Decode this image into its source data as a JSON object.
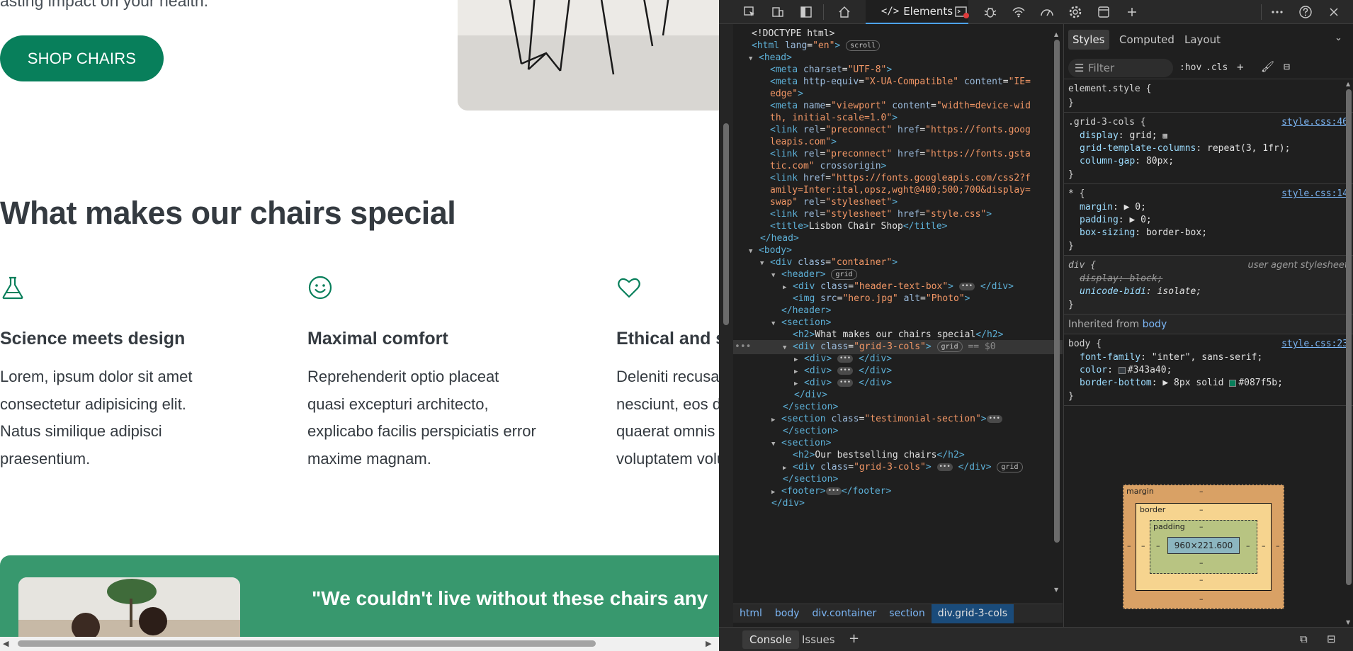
{
  "site": {
    "hero_text": "asting impact on your health.",
    "shop_button": "SHOP CHAIRS",
    "section_title": "What makes our chairs special",
    "features": [
      {
        "title": "Science meets design",
        "lines": [
          "Lorem, ipsum dolor sit amet",
          "consectetur adipisicing elit.",
          "Natus similique adipisci",
          "praesentium."
        ]
      },
      {
        "title": "Maximal comfort",
        "lines": [
          "Reprehenderit optio placeat",
          "quasi excepturi architecto,",
          "explicabo facilis perspiciatis error",
          "maxime magnam."
        ]
      },
      {
        "title": "Ethical and s",
        "lines": [
          "Deleniti recusar",
          "nesciunt, eos d",
          "quaerat omnis e",
          "voluptatem volu"
        ]
      }
    ],
    "quote": "\"We couldn't live without these chairs any",
    "colors": {
      "brand": "#087f5b",
      "testimonial_bg": "#38986e",
      "text": "#343a40"
    },
    "icons": [
      "flask-icon",
      "smiley-icon",
      "heart-icon"
    ]
  },
  "devtools": {
    "tabs": {
      "elements": "Elements"
    },
    "toolbar_icons": [
      "inspect-icon",
      "device-icon",
      "dock-icon",
      "home-icon",
      "elements-icon",
      "console-icon",
      "bug-icon",
      "network-icon",
      "performance-icon",
      "settings-icon",
      "application-icon",
      "add-tab-icon",
      "more-icon",
      "help-icon",
      "close-icon"
    ],
    "dom": {
      "doctype": "<!DOCTYPE html>",
      "html_open_tag": "html",
      "html_lang_attr": "lang",
      "html_lang": "\"en\"",
      "scroll_badge": "scroll",
      "head_tag": "head",
      "meta1_tag": "meta",
      "meta1_attr": "charset",
      "meta1_val": "\"UTF-8\"",
      "meta2_tag": "meta",
      "meta2_attr": "http-equiv",
      "meta2_val": "\"X-UA-Compatible\"",
      "meta2_attr2": "content",
      "meta2_val2": "\"IE=",
      "meta2_cont": "edge\"",
      "meta3_tag": "meta",
      "meta3_attr": "name",
      "meta3_val": "\"viewport\"",
      "meta3_attr2": "content",
      "meta3_val2": "\"width=device-wid",
      "meta3_cont": "th, initial-scale=1.0\"",
      "link1_tag": "link",
      "link1_attr": "rel",
      "link1_val": "\"preconnect\"",
      "link1_attr2": "href",
      "link1_val2": "\"https://fonts.goog",
      "link1_cont": "leapis.com\"",
      "link2_tag": "link",
      "link2_attr": "rel",
      "link2_val": "\"preconnect\"",
      "link2_attr2": "href",
      "link2_val2": "\"https://fonts.gsta",
      "link2_cont": "tic.com\"",
      "link2_attr3": "crossorigin",
      "link3_tag": "link",
      "link3_attr": "href",
      "link3_val": "\"https://fonts.googleapis.com/css2?f",
      "link3_cont1": "amily=Inter:ital,opsz,wght@400;500;700&display=",
      "link3_cont2": "swap\"",
      "link3_attr2": "rel",
      "link3_val2": "\"stylesheet\"",
      "link4_tag": "link",
      "link4_attr": "rel",
      "link4_val": "\"stylesheet\"",
      "link4_attr2": "href",
      "link4_val2": "\"style.css\"",
      "title_tag": "title",
      "title_text": "Lisbon Chair Shop",
      "head_close": "head",
      "body_tag": "body",
      "container_tag": "div",
      "container_attr": "class",
      "container_val": "\"container\"",
      "header_tag": "header",
      "grid_badge": "grid",
      "htb_tag": "div",
      "htb_attr": "class",
      "htb_val": "\"header-text-box\"",
      "img_tag": "img",
      "img_attr": "src",
      "img_val": "\"hero.jpg\"",
      "img_attr2": "alt",
      "img_val2": "\"Photo\"",
      "header_close": "header",
      "section_tag": "section",
      "h2_tag": "h2",
      "h2_text": "What makes our chairs special",
      "grid_tag": "div",
      "grid_attr": "class",
      "grid_val": "\"grid-3-cols\"",
      "grid_marker": "== $0",
      "div_tag": "div",
      "section_close": "section",
      "tsection_attr": "class",
      "tsection_val": "\"testimonial-section\"",
      "h2b_text": "Our bestselling chairs",
      "footer_tag": "footer",
      "dots": "•••"
    },
    "breadcrumbs": [
      "html",
      "body",
      "div.container",
      "section",
      "div.grid-3-cols"
    ],
    "styles": {
      "tabs": [
        "Styles",
        "Computed",
        "Layout"
      ],
      "filter_placeholder": "Filter",
      "hov": ":hov",
      "cls": ".cls",
      "element_style": "element.style {",
      "close_brace": "}",
      "rule1_selector": ".grid-3-cols {",
      "rule1_src": "style.css:46",
      "rule1_decls": [
        [
          "display",
          "grid;"
        ],
        [
          "grid-template-columns",
          "repeat(3, 1fr);"
        ],
        [
          "column-gap",
          "80px;"
        ]
      ],
      "rule2_selector": "* {",
      "rule2_src": "style.css:14",
      "rule2_decls": [
        [
          "margin",
          "0;"
        ],
        [
          "padding",
          "0;"
        ],
        [
          "box-sizing",
          "border-box;"
        ]
      ],
      "rule3_selector": "div {",
      "rule3_src": "user agent stylesheet",
      "rule3_decls": [
        [
          "display",
          "block;"
        ],
        [
          "unicode-bidi",
          "isolate;"
        ]
      ],
      "inherited_label": "Inherited from",
      "inherited_link": "body",
      "rule4_selector": "body {",
      "rule4_src": "style.css:23",
      "rule4_decls": [
        [
          "font-family",
          "\"inter\", sans-serif;"
        ],
        [
          "color",
          "#343a40;"
        ],
        [
          "border-bottom",
          "8px solid #087f5b;"
        ]
      ],
      "colors": {
        "swatch_text": "#343a40",
        "swatch_border": "#087f5b"
      }
    },
    "boxmodel": {
      "margin": "margin",
      "border": "border",
      "padding": "padding",
      "content": "960×221.600",
      "dash": "–"
    },
    "console": {
      "tabs": [
        "Console",
        "Issues"
      ]
    }
  }
}
